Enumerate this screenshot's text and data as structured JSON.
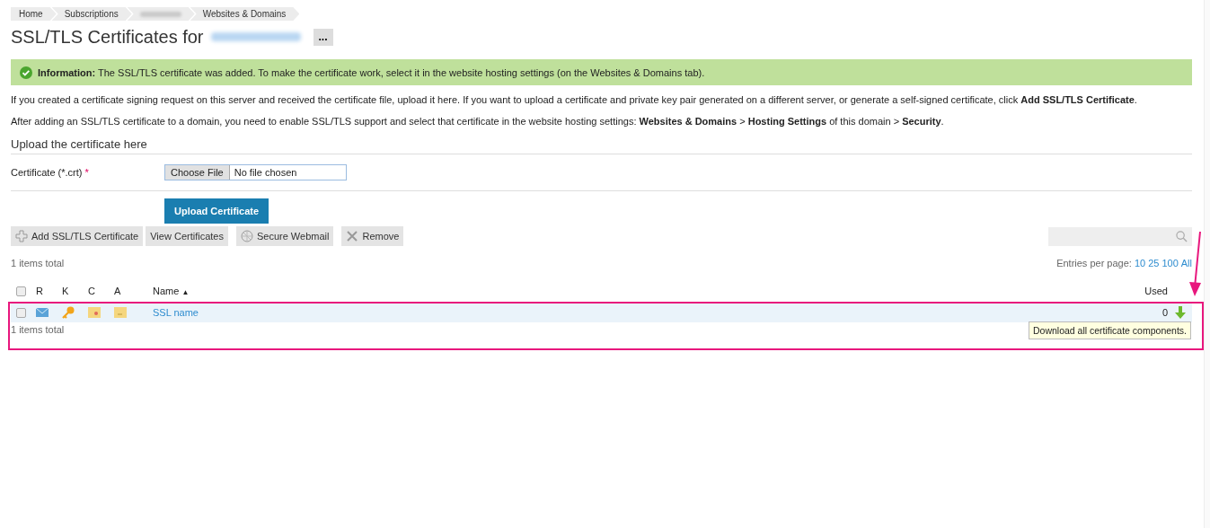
{
  "breadcrumbs": [
    {
      "kind": "link",
      "label": "Home"
    },
    {
      "kind": "link",
      "label": "Subscriptions"
    },
    {
      "kind": "blurred"
    },
    {
      "kind": "link",
      "label": "Websites & Domains"
    }
  ],
  "title": {
    "text": "SSL/TLS Certificates for",
    "domain_blurred": true,
    "more_button": "..."
  },
  "message": {
    "label": "Information:",
    "text": "The SSL/TLS certificate was added. To make the certificate work, select it in the website hosting settings (on the Websites & Domains tab)."
  },
  "paragraphs": [
    "If you created a certificate signing request on this server and received the certificate file, upload it here. If you want to upload a certificate and private key pair generated on a different server, or generate a self-signed certificate, click **Add SSL/TLS Certificate**.",
    "After adding an SSL/TLS certificate to a domain, you need to enable SSL/TLS support and select that certificate in the website hosting settings: **Websites & Domains** > **Hosting Settings** of this domain > **Security**."
  ],
  "upload": {
    "heading": "Upload the certificate here",
    "field_label": "Certificate (*.crt)",
    "required_mark": "*",
    "choose_button": "Choose File",
    "file_status": "No file chosen",
    "submit": "Upload Certificate"
  },
  "toolbar": [
    {
      "kind": "add",
      "label": "Add SSL/TLS Certificate"
    },
    {
      "kind": "plain",
      "label": "View Certificates"
    },
    {
      "kind": "webmail",
      "label": "Secure Webmail"
    },
    {
      "kind": "remove",
      "label": "Remove"
    }
  ],
  "items_total_top": "1 items total",
  "entries_per_page": {
    "label": "Entries per page:",
    "options": [
      "10",
      "25",
      "100",
      "All"
    ]
  },
  "table": {
    "select_all_checked": false,
    "columns": [
      "R",
      "K",
      "C",
      "A",
      "Name",
      "Used"
    ],
    "sort_marker": "▲",
    "rows": [
      {
        "checked": false,
        "name": "SSL name",
        "used": "0"
      }
    ]
  },
  "items_total_bottom": "1 items total",
  "tooltip": "Download all certificate components."
}
